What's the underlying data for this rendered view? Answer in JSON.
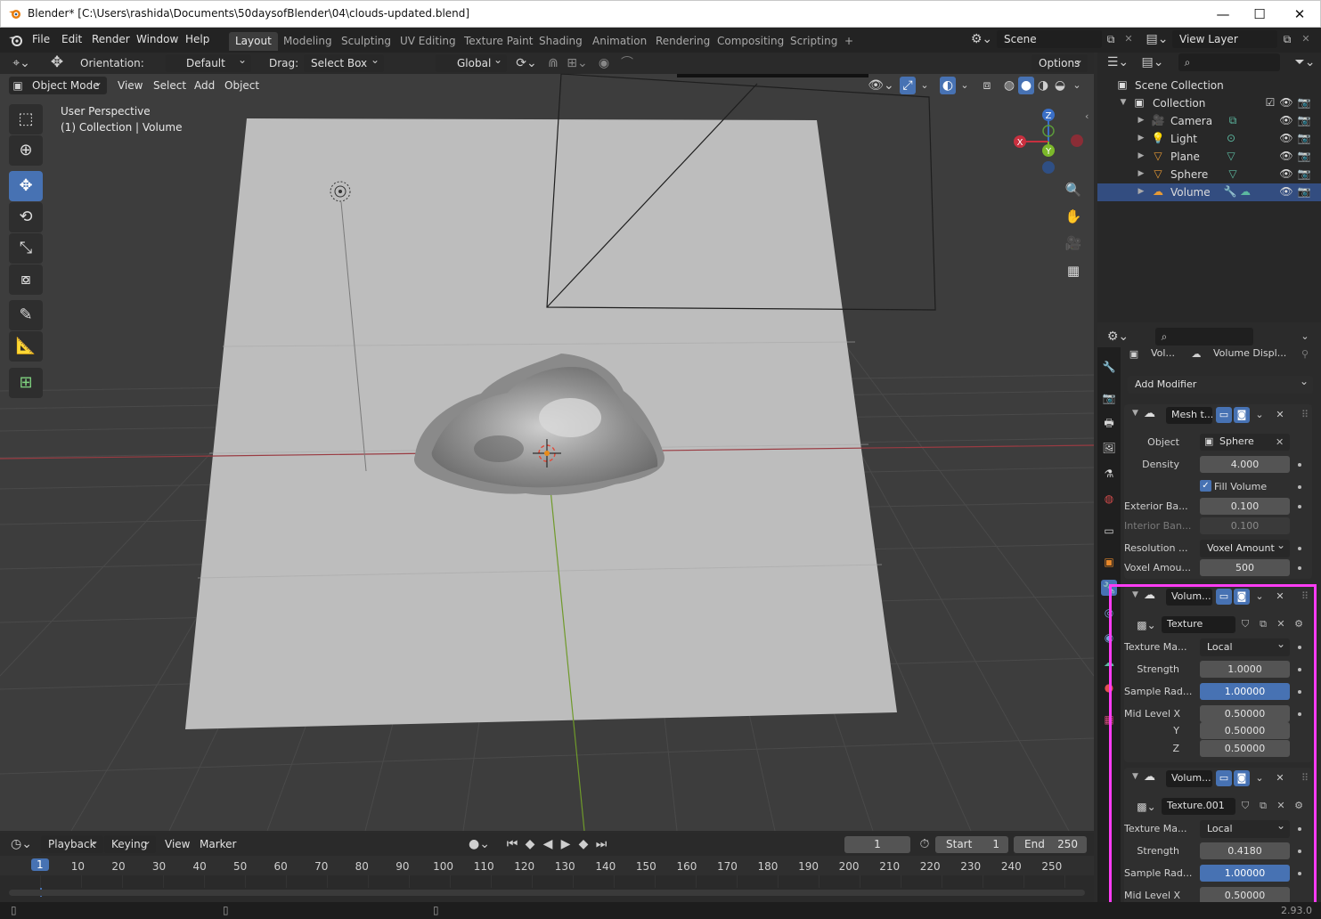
{
  "window": {
    "title": "Blender* [C:\\Users\\rashida\\Documents\\50daysofBlender\\04\\clouds-updated.blend]",
    "minimize": "—",
    "maximize": "☐",
    "close": "✕"
  },
  "menubar": {
    "items": [
      "File",
      "Edit",
      "Render",
      "Window",
      "Help"
    ],
    "workspaces": [
      "Layout",
      "Modeling",
      "Sculpting",
      "UV Editing",
      "Texture Paint",
      "Shading",
      "Animation",
      "Rendering",
      "Compositing",
      "Scripting"
    ],
    "active_workspace": "Layout",
    "add_tab": "+",
    "scene": "Scene",
    "view_layer": "View Layer"
  },
  "viewport_header": {
    "orientation_label": "Orientation:",
    "orientation_value": "Default",
    "drag_label": "Drag:",
    "drag_value": "Select Box",
    "transform_orientation": "Global",
    "options": "Options",
    "mode": "Object Mode",
    "menus": [
      "View",
      "Select",
      "Add",
      "Object"
    ]
  },
  "viewport": {
    "perspective": "User Perspective",
    "collection_info": "(1) Collection | Volume",
    "gizmo": {
      "x": "X",
      "y": "Y",
      "z": "Z"
    }
  },
  "outliner": {
    "root": "Scene Collection",
    "collection": "Collection",
    "objects": [
      {
        "name": "Camera",
        "color": "#e69a35",
        "data_color": "#5cb8a0"
      },
      {
        "name": "Light",
        "color": "#e69a35",
        "data_color": "#5cb8a0"
      },
      {
        "name": "Plane",
        "color": "#e69a35",
        "data_color": "#5cb8a0"
      },
      {
        "name": "Sphere",
        "color": "#e69a35",
        "data_color": "#5cb8a0"
      },
      {
        "name": "Volume",
        "color": "#e69a35",
        "data_color": "#5cb8a0"
      }
    ]
  },
  "properties": {
    "breadcrumb_object": "Vol...",
    "breadcrumb_data": "Volume Displ...",
    "add_modifier": "Add Modifier",
    "mesh_to_volume": {
      "name": "Mesh t...",
      "object_label": "Object",
      "object_value": "Sphere",
      "density_label": "Density",
      "density": "4.000",
      "fill_volume": "Fill Volume",
      "exterior_label": "Exterior Ba...",
      "exterior": "0.100",
      "interior_label": "Interior Ban...",
      "interior": "0.100",
      "resolution_label": "Resolution ...",
      "resolution": "Voxel Amount",
      "voxel_label": "Voxel Amou...",
      "voxel": "500"
    },
    "displace_1": {
      "name": "Volum...",
      "texture": "Texture",
      "texture_map_label": "Texture Ma...",
      "texture_map": "Local",
      "strength_label": "Strength",
      "strength": "1.0000",
      "sample_label": "Sample Rad...",
      "sample": "1.00000",
      "midx_label": "Mid Level X",
      "midx": "0.50000",
      "midy_label": "Y",
      "midy": "0.50000",
      "midz_label": "Z",
      "midz": "0.50000"
    },
    "displace_2": {
      "name": "Volum...",
      "texture": "Texture.001",
      "texture_map_label": "Texture Ma...",
      "texture_map": "Local",
      "strength_label": "Strength",
      "strength": "0.4180",
      "sample_label": "Sample Rad...",
      "sample": "1.00000",
      "midx_label": "Mid Level X",
      "midx": "0.50000"
    }
  },
  "timeline": {
    "menus": [
      "Playback",
      "Keying",
      "View",
      "Marker"
    ],
    "current_frame": "1",
    "start_label": "Start",
    "start": "1",
    "end_label": "End",
    "end": "250",
    "ticks": [
      "1",
      "10",
      "20",
      "30",
      "40",
      "50",
      "60",
      "70",
      "80",
      "90",
      "100",
      "110",
      "120",
      "130",
      "140",
      "150",
      "160",
      "170",
      "180",
      "190",
      "200",
      "210",
      "220",
      "230",
      "240",
      "250"
    ]
  },
  "status": {
    "version": "2.93.0"
  },
  "colors": {
    "accent": "#4772b3",
    "highlight": "#ff3cf5",
    "x_axis": "#c8303f",
    "y_axis": "#7cb82a",
    "z_axis": "#3a6fc7"
  }
}
